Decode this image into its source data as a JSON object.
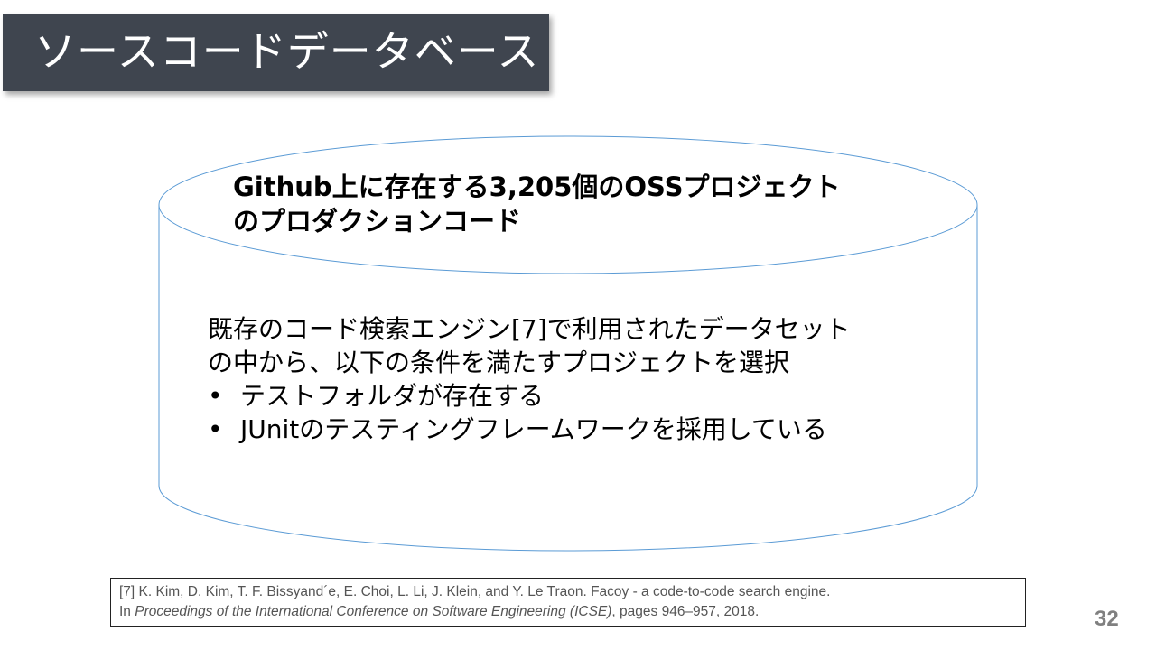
{
  "title": "ソースコードデータベース",
  "database": {
    "heading_line1": "Github上に存在する3,205個のOSSプロジェクト",
    "heading_line2": "のプロダクションコード",
    "body_line1": "既存のコード検索エンジン[7]で利用されたデータセット",
    "body_line2": "の中から、以下の条件を満たすプロジェクトを選択",
    "bullets": [
      "テストフォルダが存在する",
      "JUnitのテスティングフレームワークを採用している"
    ]
  },
  "reference": {
    "line1": "[7] K. Kim, D. Kim, T. F. Bissyand´e, E. Choi, L. Li, J. Klein, and Y. Le Traon. Facoy - a code-to-code search engine.",
    "line2_prefix": "In ",
    "line2_venue": "Proceedings of the International Conference on Software Engineering (ICSE)",
    "line2_suffix": ", pages 946–957, 2018."
  },
  "page_number": "32",
  "colors": {
    "title_bg": "#3f454f",
    "cylinder_stroke": "#5b9bd5"
  }
}
